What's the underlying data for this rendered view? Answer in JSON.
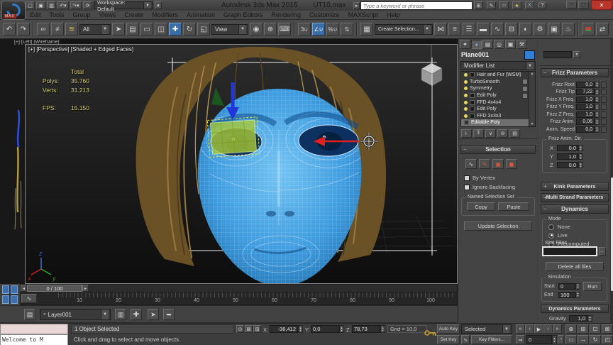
{
  "titlebar": {
    "app_title": "Autodesk 3ds Max 2015",
    "file_name": "UT10.max",
    "workspace": "Workspace: Default",
    "search_placeholder": "Type a keyword or phrase"
  },
  "menubar": {
    "items": [
      "Edit",
      "Tools",
      "Group",
      "Views",
      "Create",
      "Modifiers",
      "Animation",
      "Graph Editors",
      "Rendering",
      "Customize",
      "MAXScript",
      "Help"
    ]
  },
  "toolbar": {
    "selection_filter": "All",
    "coordinate_system": "View",
    "named_selection_sets": "Create Selection...",
    "snap_label": "3"
  },
  "viewport": {
    "left_label": "[+] [Left] [Wireframe]",
    "perspective_label": "[+] [Perspective] [Shaded + Edged Faces]",
    "stats": {
      "total_label": "Total",
      "polys_label": "Polys:",
      "polys_value": "35.760",
      "verts_label": "Verts:",
      "verts_value": "31.213",
      "fps_label": "FPS:",
      "fps_value": "15.150"
    },
    "axis_x": "x",
    "axis_y": "y",
    "axis_z": "z"
  },
  "timeline": {
    "slider_label": "0 / 100",
    "ticks": [
      "10",
      "20",
      "30",
      "40",
      "50",
      "60",
      "70",
      "80",
      "90",
      "100"
    ]
  },
  "layer_toolbar": {
    "current_layer": "Layer001"
  },
  "status_bar": {
    "listener_text": "Welcome to M",
    "prompt_line": "1 Object Selected",
    "status_line": "Click and drag to select and move objects",
    "x_label": "X:",
    "x_value": "-36,412",
    "y_label": "Y:",
    "y_value": "0,0",
    "z_label": "Z:",
    "z_value": "78,73",
    "grid_label": "Grid = 10,0"
  },
  "animation": {
    "auto_key": "Auto Key",
    "set_key": "Set Key",
    "selection_set": "Selected",
    "key_filters": "Key Filters...",
    "frame_field": "0"
  },
  "command_panel": {
    "object_name": "Plane001",
    "modifier_list_label": "Modifier List",
    "modifiers": [
      "Hair and Fur (WSM)",
      "TurboSmooth",
      "Symmetry",
      "Edit Poly",
      "FFD 4x4x4",
      "Edit Poly",
      "FFD 3x3x3",
      "Editable Poly"
    ],
    "selection_rollout": {
      "title": "Selection",
      "by_vertex": "By Vertex",
      "ignore_backfacing": "Ignore Backfacing",
      "named_group": "Named Selection Set",
      "copy": "Copy",
      "paste": "Paste",
      "update_selection": "Update Selection"
    }
  },
  "hair_panel": {
    "frizz_title": "Frizz Parameters",
    "frizz_rows": [
      {
        "label": "Frizz Root",
        "value": "0,0"
      },
      {
        "label": "Frizz Tip",
        "value": "7,22"
      },
      {
        "label": "Frizz X Freq.",
        "value": "1,0"
      },
      {
        "label": "Frizz Y Freq.",
        "value": "1,0"
      },
      {
        "label": "Frizz Z Freq.",
        "value": "1,0"
      },
      {
        "label": "Frizz Anim.",
        "value": "0,06"
      },
      {
        "label": "Anim. Speed",
        "value": "0,0"
      }
    ],
    "dir_group": {
      "title": "Frizz Anim. Dir.",
      "x_label": "X",
      "x_value": "0,0",
      "y_label": "Y",
      "y_value": "1,0",
      "z_label": "Z",
      "z_value": "0,0"
    },
    "kink_title": "Kink Parameters",
    "multi_strand_title": "Multi Strand Parameters",
    "dynamics_title": "Dynamics",
    "mode_group": {
      "title": "Mode",
      "none": "None",
      "live": "Live",
      "precomputed": "Precomputed"
    },
    "stat_files_label": "Stat Files",
    "delete_all_files": "Delete all files",
    "simulation_group": {
      "title": "Simulation",
      "start_label": "Start",
      "start_value": "0",
      "end_label": "End",
      "end_value": "100",
      "run": "Run"
    },
    "dynamics_params_title": "Dynamics Parameters",
    "gravity_label": "Gravity",
    "gravity_value": "1,0"
  },
  "colors": {
    "accent_blue": "#3a6ea8",
    "close_red": "#b8372a",
    "face_blue": "#3d9ce0",
    "hair_brown": "#6b5226",
    "stats_yellow": "#d8d06a",
    "object_color": "#2f7fd6"
  }
}
